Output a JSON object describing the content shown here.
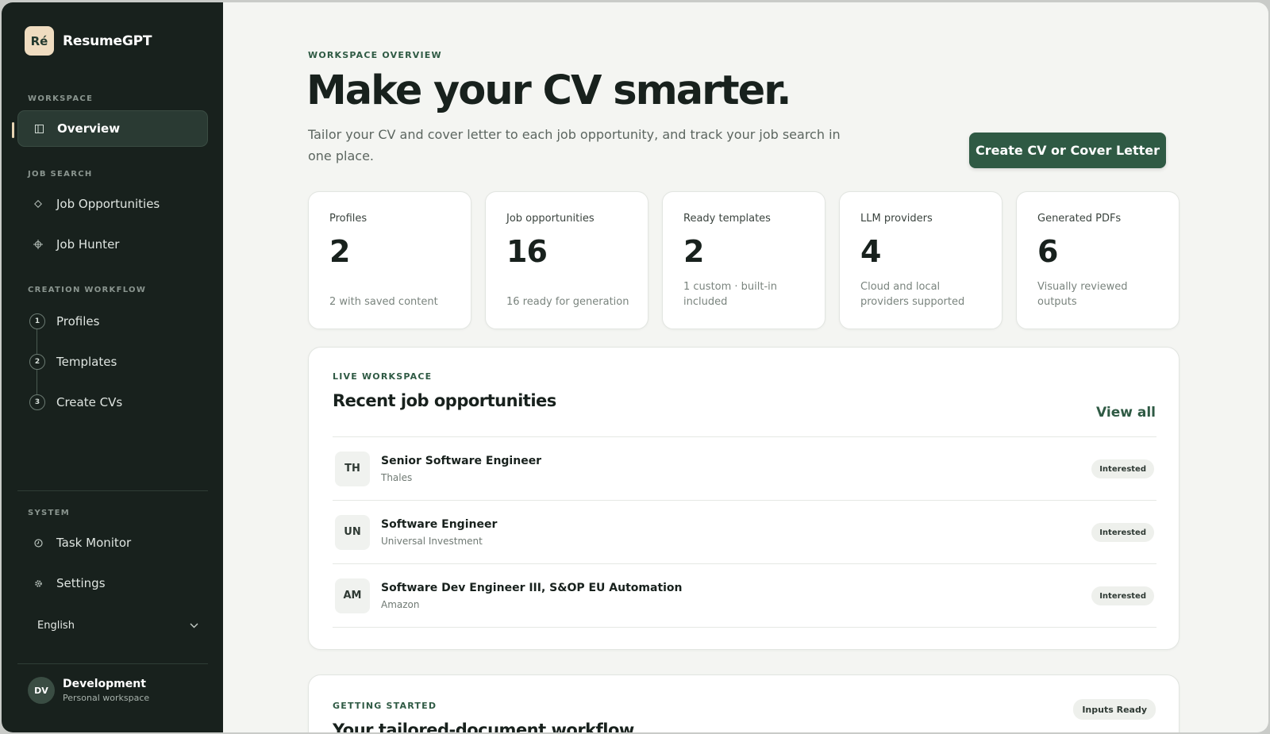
{
  "app": {
    "logo": "Ré",
    "name": "ResumeGPT"
  },
  "sidebar": {
    "sections": {
      "workspace": "WORKSPACE",
      "job_search": "JOB SEARCH",
      "creation": "CREATION WORKFLOW",
      "system": "SYSTEM"
    },
    "items": {
      "overview": {
        "label": "Overview",
        "icon": "panel-icon",
        "active": true
      },
      "job_opportunities": {
        "label": "Job Opportunities",
        "icon": "diamond-icon"
      },
      "job_hunter": {
        "label": "Job Hunter",
        "icon": "crosshair-icon"
      },
      "profiles": {
        "label": "Profiles",
        "step": "1"
      },
      "templates": {
        "label": "Templates",
        "step": "2"
      },
      "create_cvs": {
        "label": "Create CVs",
        "step": "3"
      },
      "task_monitor": {
        "label": "Task Monitor",
        "icon": "clock-icon"
      },
      "settings": {
        "label": "Settings",
        "icon": "gear-icon"
      }
    },
    "language": "English",
    "user": {
      "initials": "DV",
      "name": "Development",
      "workspace": "Personal workspace"
    }
  },
  "hero": {
    "eyebrow": "WORKSPACE OVERVIEW",
    "title": "Make your CV smarter.",
    "subtitle": "Tailor your CV and cover letter to each job opportunity, and track your job search in one place.",
    "cta": "Create CV or Cover Letter"
  },
  "stats": [
    {
      "label": "Profiles",
      "value": "2",
      "note": "2 with saved content"
    },
    {
      "label": "Job opportunities",
      "value": "16",
      "note": "16 ready for generation"
    },
    {
      "label": "Ready templates",
      "value": "2",
      "note": "1 custom · built-in included"
    },
    {
      "label": "LLM providers",
      "value": "4",
      "note": "Cloud and local providers supported"
    },
    {
      "label": "Generated PDFs",
      "value": "6",
      "note": "Visually reviewed outputs"
    }
  ],
  "recent": {
    "eyebrow": "LIVE WORKSPACE",
    "title": "Recent job opportunities",
    "view_all": "View all",
    "jobs": [
      {
        "initials": "TH",
        "title": "Senior Software Engineer",
        "company": "Thales",
        "status": "Interested"
      },
      {
        "initials": "UN",
        "title": "Software Engineer",
        "company": "Universal Investment",
        "status": "Interested"
      },
      {
        "initials": "AM",
        "title": "Software Dev Engineer III, S&OP EU Automation",
        "company": "Amazon",
        "status": "Interested"
      }
    ]
  },
  "getting_started": {
    "eyebrow": "GETTING STARTED",
    "title": "Your tailored-document workflow",
    "badge": "Inputs Ready"
  },
  "colors": {
    "sidebar_bg": "#18211d",
    "accent": "#2f5a44",
    "page_bg": "#f4f5f2"
  }
}
